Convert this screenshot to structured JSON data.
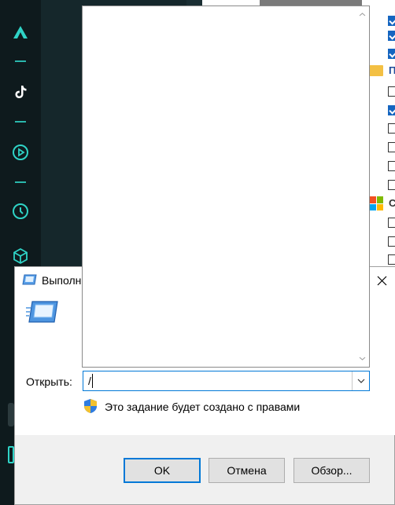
{
  "dialog": {
    "title": "Выполн",
    "open_label": "Открыть:",
    "input_value": "/",
    "admin_notice": "Это задание будет создано с правами",
    "buttons": {
      "ok": "OK",
      "cancel": "Отмена",
      "browse": "Обзор..."
    }
  },
  "background_list": {
    "folder_label": "П",
    "windows_label": "С"
  },
  "colors": {
    "accent": "#2fd3c6",
    "focus_blue": "#0078d7",
    "checkbox_blue": "#1565c0"
  },
  "icons": [
    "app-logo-icon",
    "tiktok-icon",
    "play-icon",
    "clock-icon",
    "cube-icon",
    "run-icon",
    "shield-icon",
    "close-icon",
    "chevron-down-icon"
  ]
}
